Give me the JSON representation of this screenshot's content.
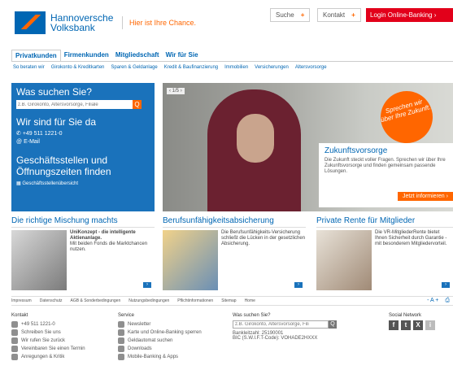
{
  "header": {
    "bank_name_line1": "Hannoversche",
    "bank_name_line2": "Volksbank",
    "claim": "Hier ist Ihre Chance.",
    "search_label": "Suche",
    "contact_label": "Kontakt",
    "login_label": "Login Online-Banking",
    "plus_symbol": "+",
    "chevron": "›"
  },
  "tabs": [
    "Privatkunden",
    "Firmenkunden",
    "Mitgliedschaft",
    "Wir für Sie"
  ],
  "subnav": [
    "So beraten wir",
    "Girokonto & Kreditkarten",
    "Sparen & Geldanlage",
    "Kredit & Baufinanzierung",
    "Immobilien",
    "Versicherungen",
    "Altersvorsorge"
  ],
  "left_panel": {
    "heading": "Was suchen Sie?",
    "search_placeholder": "z.B. Girokonto, Altersvorsorge, Filiale",
    "search_icon": "Q",
    "contact_heading": "Wir sind für Sie da",
    "phone": "+49 511 1221-0",
    "email": "E-Mail",
    "branches_heading": "Geschäftsstellen und Öffnungszeiten finden",
    "branches_link": "Geschäftsstellenübersicht"
  },
  "hero": {
    "pager": "1/5",
    "sticker": "Sprechen wir über Ihre Zukunft.",
    "title": "Zukunftsvorsorge",
    "text": "Die Zukunft steckt voller Fragen. Sprechen wir über Ihre Zukunftsvorsorge und finden gemeinsam passende Lösungen.",
    "button": "Jetzt informieren"
  },
  "teasers": [
    {
      "title": "Die richtige Mischung machts",
      "bold": "UniKonzept - die intelligente Aktienanlage.",
      "text": "Mit beiden Fonds die Marktchancen nutzen."
    },
    {
      "title": "Berufsunfähigkeitsabsicherung",
      "bold": "",
      "text": "Die Berufsunfähigkeits-Versicherung schließt die Lücken in der gesetzlichen Absicherung."
    },
    {
      "title": "Private Rente für Mitglieder",
      "bold": "",
      "text": "Die VR-MitgliederRente bietet Ihnen Sicherheit durch Garantie - mit besonderem Mitgliedervorteil."
    }
  ],
  "footer_bar": [
    "Impressum",
    "Datenschutz",
    "AGB & Sonderbedingungen",
    "Nutzungsbedingungen",
    "Pflichtinformationen",
    "Sitemap",
    "Home"
  ],
  "footer_tools": {
    "font": "- A +",
    "print": "⎙"
  },
  "footer": {
    "contact_h": "Kontakt",
    "contact_items": [
      "+49 511 1221-0",
      "Schreiben Sie uns",
      "Wir rufen Sie zurück",
      "Vereinbaren Sie einen Termin",
      "Anregungen & Kritik"
    ],
    "service_h": "Service",
    "service_items": [
      "Newsletter",
      "Karte und Online-Banking sperren",
      "Geldautomat suchen",
      "Downloads",
      "Mobile-Banking & Apps"
    ],
    "search_h": "Was suchen Sie?",
    "search_placeholder": "z.B. Girokonto, Altersvorsorge, Fili",
    "blz": "Bankleitzahl: 25190001",
    "bic": "BIC (S.W.I.F.T-Code): VOHADE2HXXX",
    "social_h": "Social Network",
    "social": [
      "f",
      "t",
      "X",
      "i"
    ]
  },
  "colors": {
    "brand_blue": "#0066b3",
    "accent_orange": "#ff6600",
    "login_red": "#e2001a"
  }
}
